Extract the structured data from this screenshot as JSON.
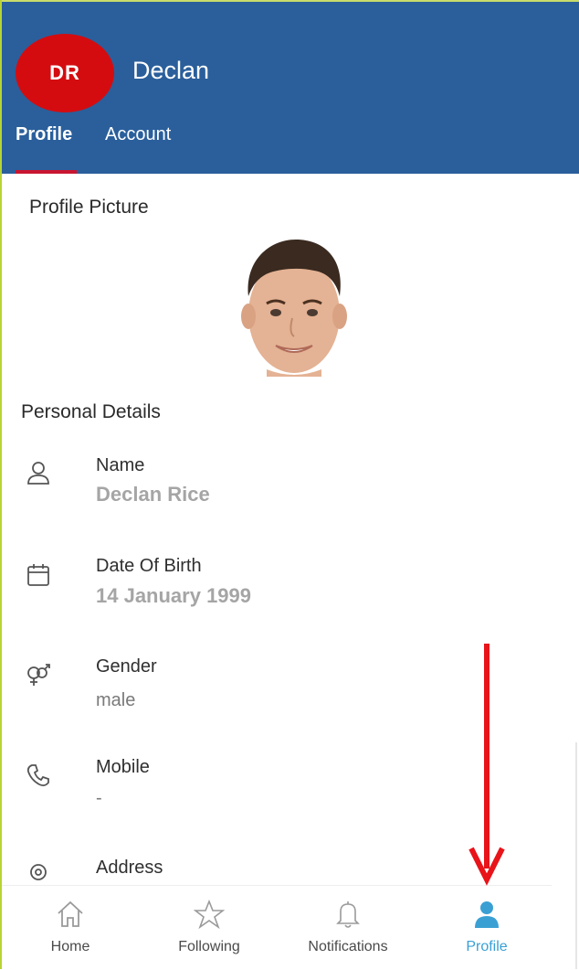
{
  "header": {
    "avatar_initials": "DR",
    "username": "Declan",
    "tabs": [
      {
        "label": "Profile",
        "active": true
      },
      {
        "label": "Account",
        "active": false
      }
    ]
  },
  "profile_picture": {
    "title": "Profile Picture"
  },
  "personal_details": {
    "title": "Personal Details",
    "fields": [
      {
        "icon": "user-icon",
        "label": "Name",
        "value": "Declan Rice"
      },
      {
        "icon": "calendar-icon",
        "label": "Date Of Birth",
        "value": "14 January 1999"
      },
      {
        "icon": "gender-icon",
        "label": "Gender",
        "value": "male"
      },
      {
        "icon": "phone-icon",
        "label": "Mobile",
        "value": "-"
      },
      {
        "icon": "location-icon",
        "label": "Address",
        "value": ""
      }
    ]
  },
  "bottom_nav": {
    "items": [
      {
        "icon": "home-icon",
        "label": "Home",
        "active": false
      },
      {
        "icon": "star-icon",
        "label": "Following",
        "active": false
      },
      {
        "icon": "bell-icon",
        "label": "Notifications",
        "active": false
      },
      {
        "icon": "person-icon",
        "label": "Profile",
        "active": true
      }
    ]
  },
  "colors": {
    "header_bg": "#2a5f9b",
    "avatar_bg": "#d40c10",
    "tab_indicator": "#c81530",
    "active_nav": "#3aa0d4",
    "annotation_arrow": "#e8141a"
  }
}
